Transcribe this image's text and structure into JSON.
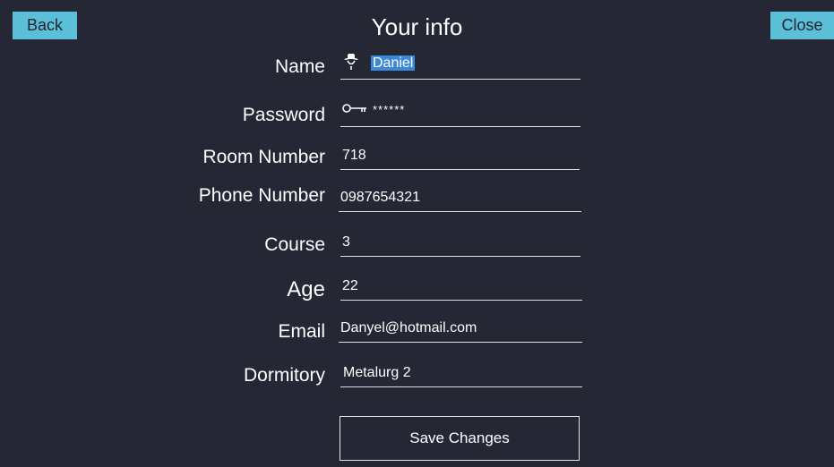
{
  "header": {
    "back_label": "Back",
    "title": "Your info",
    "close_label": "Close"
  },
  "form": {
    "name": {
      "label": "Name",
      "value": "Daniel",
      "icon": "user-icon"
    },
    "password": {
      "label": "Password",
      "value": "******",
      "icon": "key-icon"
    },
    "room_number": {
      "label": "Room Number",
      "value": "718"
    },
    "phone_number": {
      "label": "Phone Number",
      "value": "0987654321"
    },
    "course": {
      "label": "Course",
      "value": "3"
    },
    "age": {
      "label": "Age",
      "value": "22"
    },
    "email": {
      "label": "Email",
      "value": "Danyel@hotmail.com"
    },
    "dormitory": {
      "label": "Dormitory",
      "value": "Metalurg 2"
    }
  },
  "actions": {
    "save_label": "Save Changes"
  },
  "colors": {
    "background": "#252734",
    "button_accent": "#5bbfd8",
    "selection": "#3a89d8"
  }
}
